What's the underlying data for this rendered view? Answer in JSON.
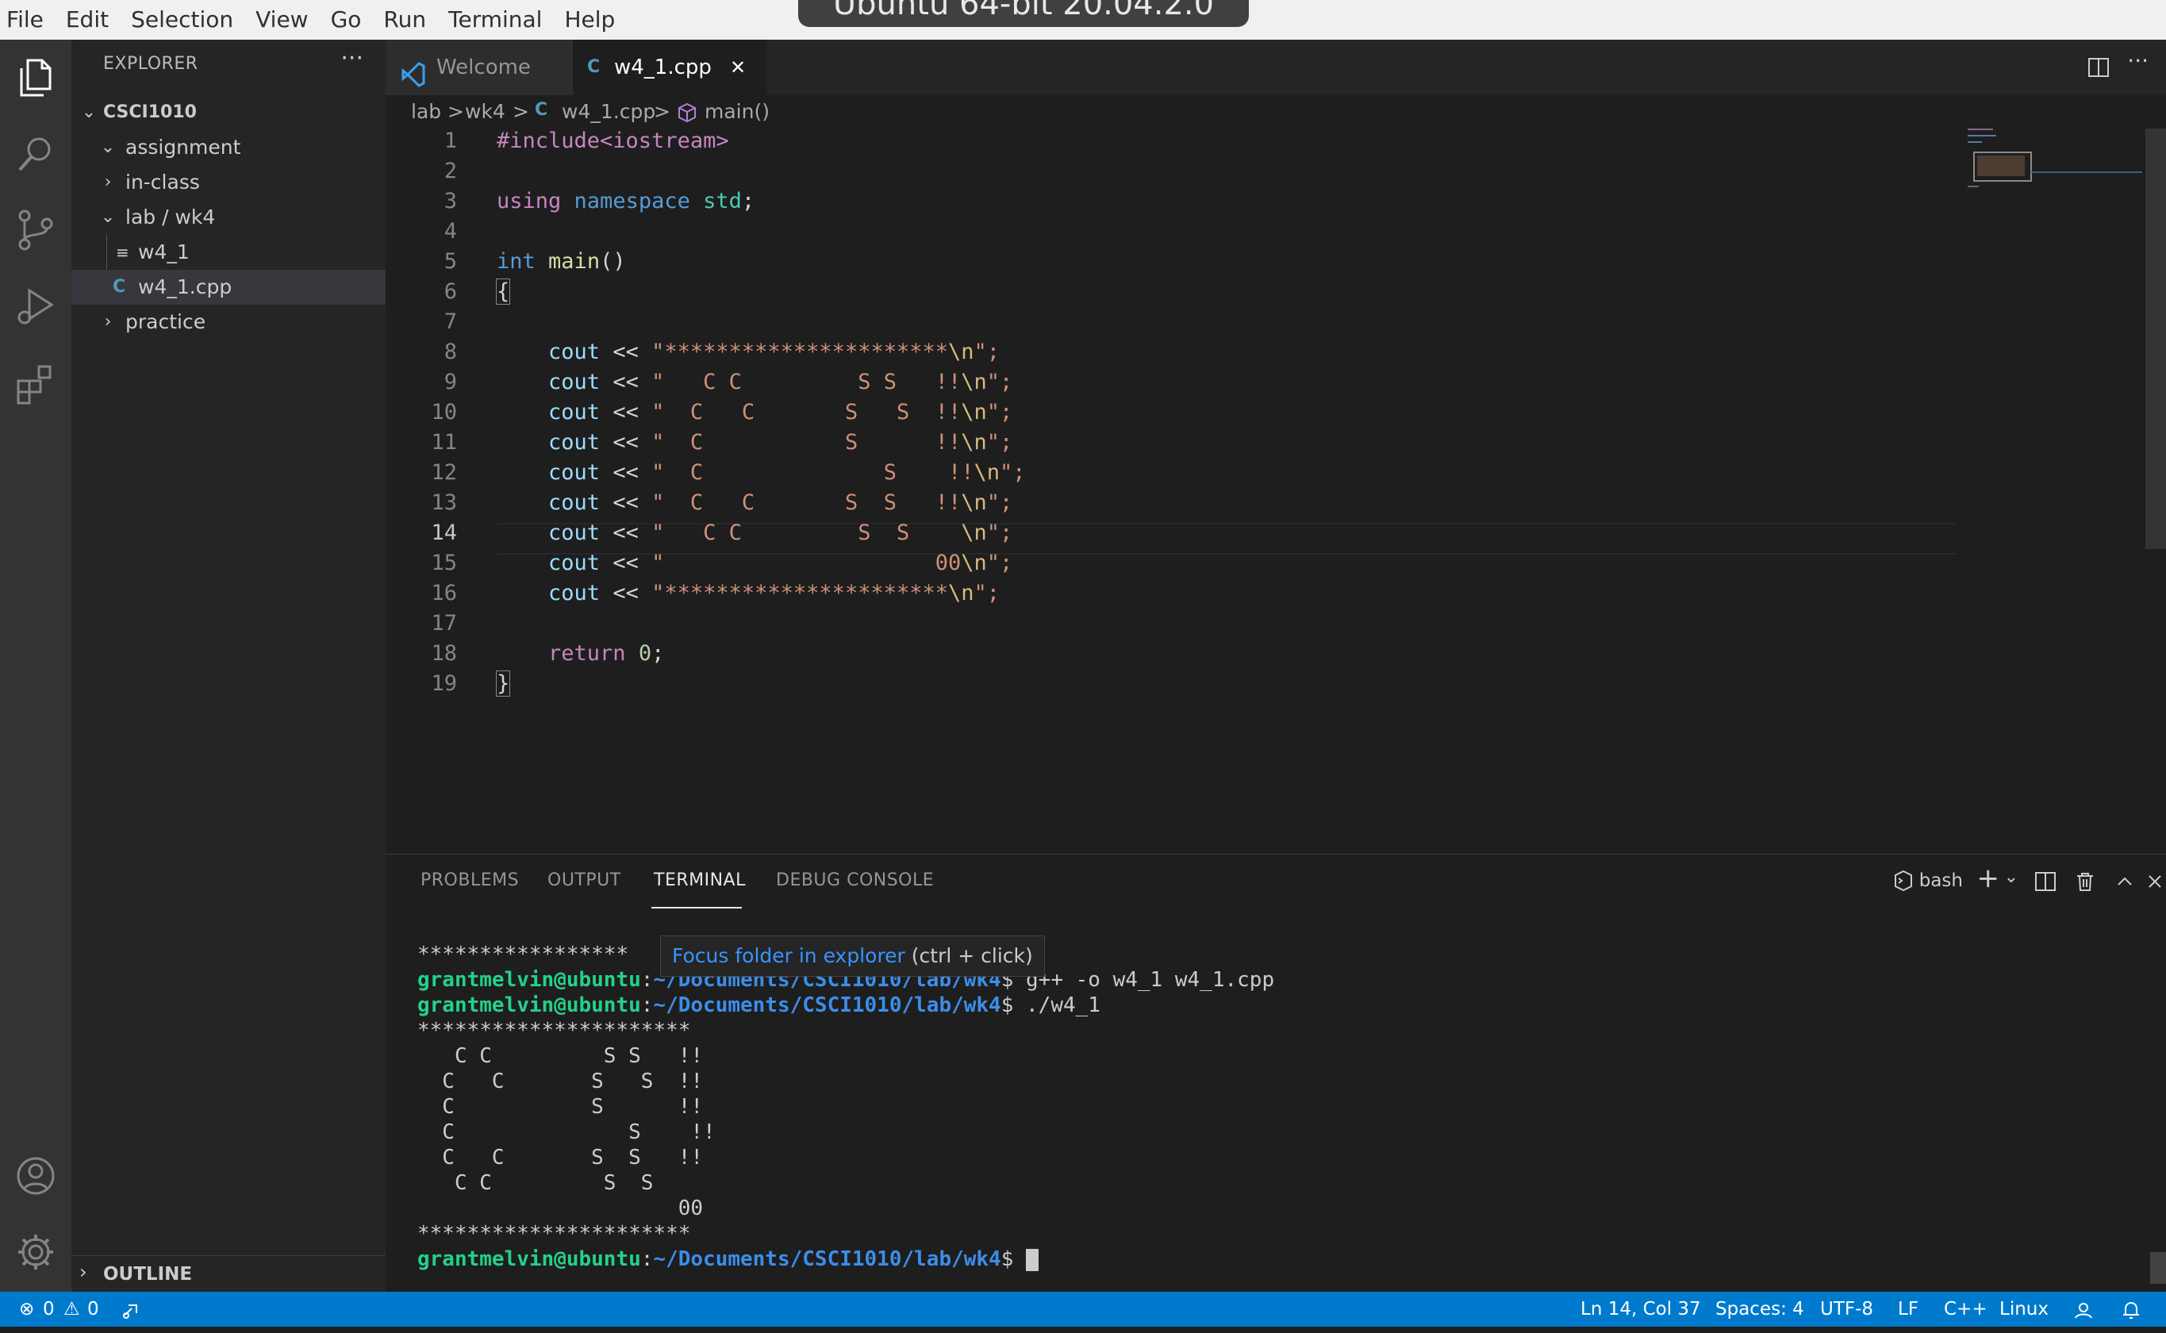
{
  "vm_title": "Ubuntu 64-bit 20.04.2.0",
  "menu": [
    "File",
    "Edit",
    "Selection",
    "View",
    "Go",
    "Run",
    "Terminal",
    "Help"
  ],
  "activity_bar": {
    "top_icons": [
      "explorer-icon",
      "search-icon",
      "source-control-icon",
      "run-debug-icon",
      "extensions-icon"
    ],
    "bottom_icons": [
      "account-icon",
      "settings-gear-icon"
    ]
  },
  "explorer": {
    "title": "EXPLORER",
    "more": "···",
    "root": "CSCI1010",
    "items": [
      {
        "label": "assignment",
        "chevron": "⌄"
      },
      {
        "label": "in-class",
        "chevron": "›"
      },
      {
        "label": "lab / wk4",
        "chevron": "⌄"
      },
      {
        "label": "w4_1",
        "icon": "≡"
      },
      {
        "label": "w4_1.cpp",
        "icon": "C"
      },
      {
        "label": "practice",
        "chevron": "›"
      }
    ],
    "outline": "OUTLINE"
  },
  "tabs": [
    {
      "label": "Welcome"
    },
    {
      "label": "w4_1.cpp",
      "close": "✕"
    }
  ],
  "breadcrumb": {
    "parts": [
      "lab",
      "wk4",
      "w4_1.cpp",
      "main()"
    ],
    "sep": ">"
  },
  "editor": {
    "line_numbers": [
      "1",
      "2",
      "3",
      "4",
      "5",
      "6",
      "7",
      "8",
      "9",
      "10",
      "11",
      "12",
      "13",
      "14",
      "15",
      "16",
      "17",
      "18",
      "19"
    ],
    "active_line": "14",
    "code": {
      "l1_pp": "#include<iostream>",
      "l3_kw": "using",
      "l3_ns": "namespace",
      "l3_std": "std",
      "l3_semi": ";",
      "l5_type": "int",
      "l5_fn": "main",
      "l5_paren": "()",
      "open_brace": "{",
      "close_brace": "}",
      "cout": "cout",
      "op": "<<",
      "strings": [
        "\"**********************",
        "\"   C C         S S   !!",
        "\"  C   C       S   S  !!",
        "\"  C           S      !!",
        "\"  C              S    !!",
        "\"  C   C       S  S   !!",
        "\"   C C         S  S    ",
        "\"                     00",
        "\"**********************"
      ],
      "esc": "\\n",
      "close_str": "\";",
      "ret": "return",
      "zero": "0",
      "semi": ";"
    }
  },
  "panel": {
    "tabs": [
      "PROBLEMS",
      "OUTPUT",
      "TERMINAL",
      "DEBUG CONSOLE"
    ],
    "shell": "bash",
    "terminal": {
      "partial": "*****************",
      "user": "grantmelvin@ubuntu",
      "colon": ":",
      "path": "~/Documents/CSCI1010/lab/wk4",
      "dollar": "$",
      "cmd1": " g++ -o w4_1 w4_1.cpp",
      "cmd2": " ./w4_1",
      "output": [
        "**********************",
        "   C C         S S   !!",
        "  C   C       S   S  !!",
        "  C           S      !!",
        "  C              S    !!",
        "  C   C       S  S   !!",
        "   C C         S  S    ",
        "                     00",
        "**********************"
      ]
    },
    "tooltip": {
      "link": "Focus folder in explorer",
      "hint": " (ctrl + click)"
    }
  },
  "status": {
    "errors": "0",
    "warnings": "0",
    "position": "Ln 14, Col 37",
    "spaces": "Spaces: 4",
    "encoding": "UTF-8",
    "eol": "LF",
    "language": "C++",
    "platform": "Linux"
  }
}
